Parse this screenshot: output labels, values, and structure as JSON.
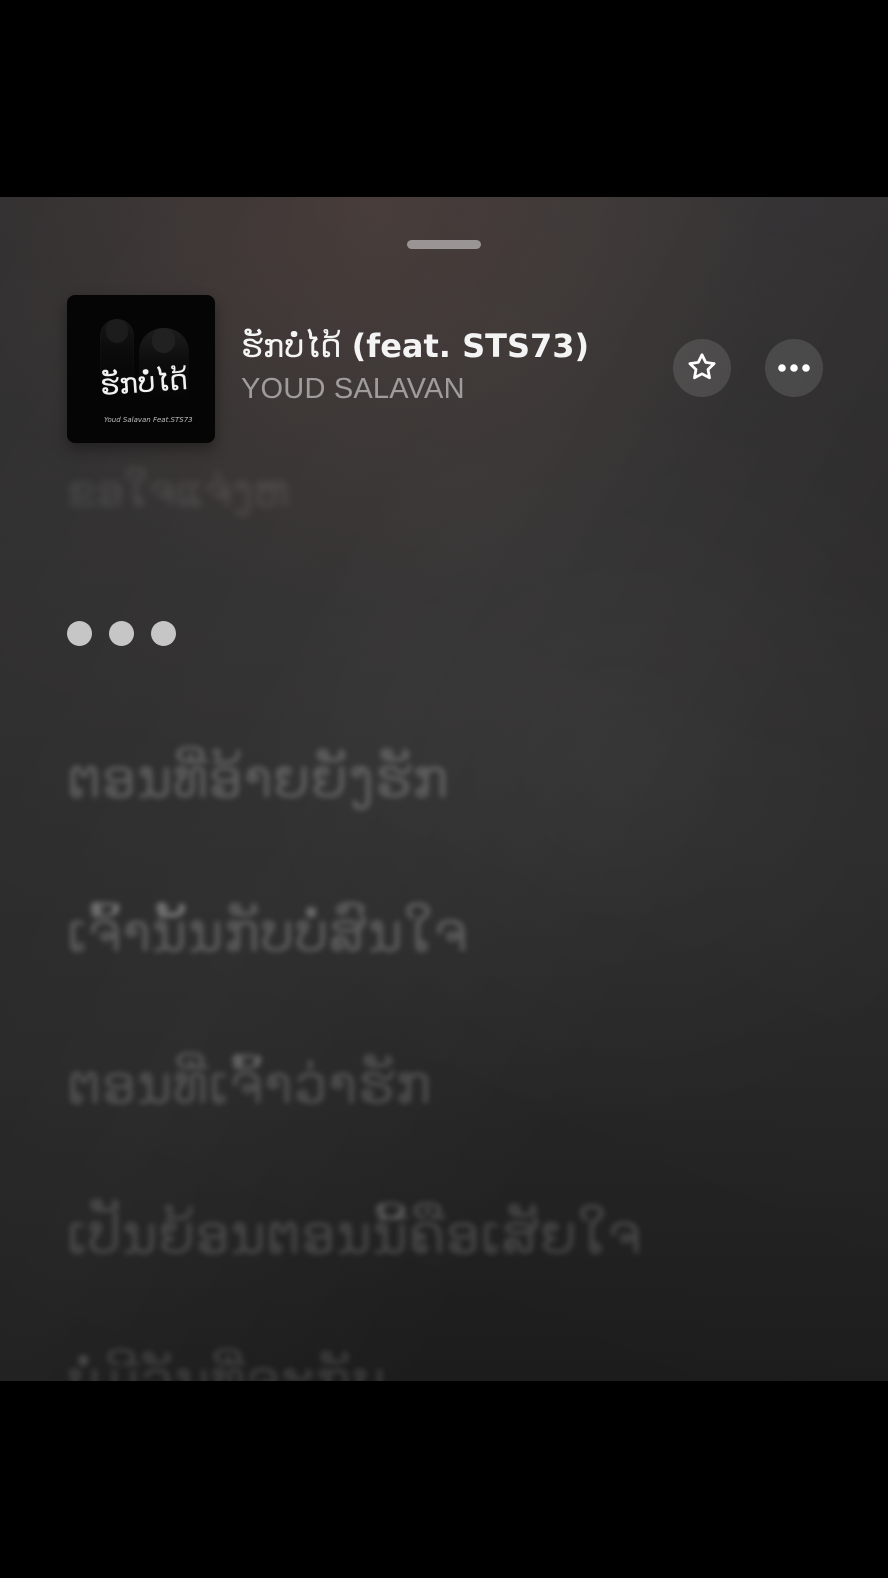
{
  "song": {
    "title_lao": "ຮັກບໍ່ໄດ້",
    "title_feat": "(feat. STS73)",
    "artist": "YOUD SALAVAN"
  },
  "artwork": {
    "title": "ຮັກບໍ່ໄດ້",
    "subtitle": "Youd Salavan Feat.STS73"
  },
  "controls": {
    "favorite_icon": "star-icon",
    "more_icon": "ellipsis-icon"
  },
  "lyrics": {
    "previous_line": "ຂອໃຈແຈ່ງຫ",
    "indicator": "three-dots",
    "lines": [
      "ຕອນທີ່ອ້າຍຍັງຮັກ",
      "ເຈົ້ານັ້ນກັບບໍ່ສົນໃຈ",
      "ຕອນທີ່ເຈົ້າວ່າຮັກ",
      "ເປັນຍ້ອນຕອນນີ້ຄືອເສັຍໃຈ",
      "ບໍ່ມີວັນທີ່ຈະກັບ"
    ]
  },
  "colors": {
    "background": "#000000",
    "sheet_top": "#312f30",
    "sheet_bottom": "#1b1b1b",
    "primary_text": "#f4f4f4",
    "secondary_text": "#8a8a8a"
  }
}
